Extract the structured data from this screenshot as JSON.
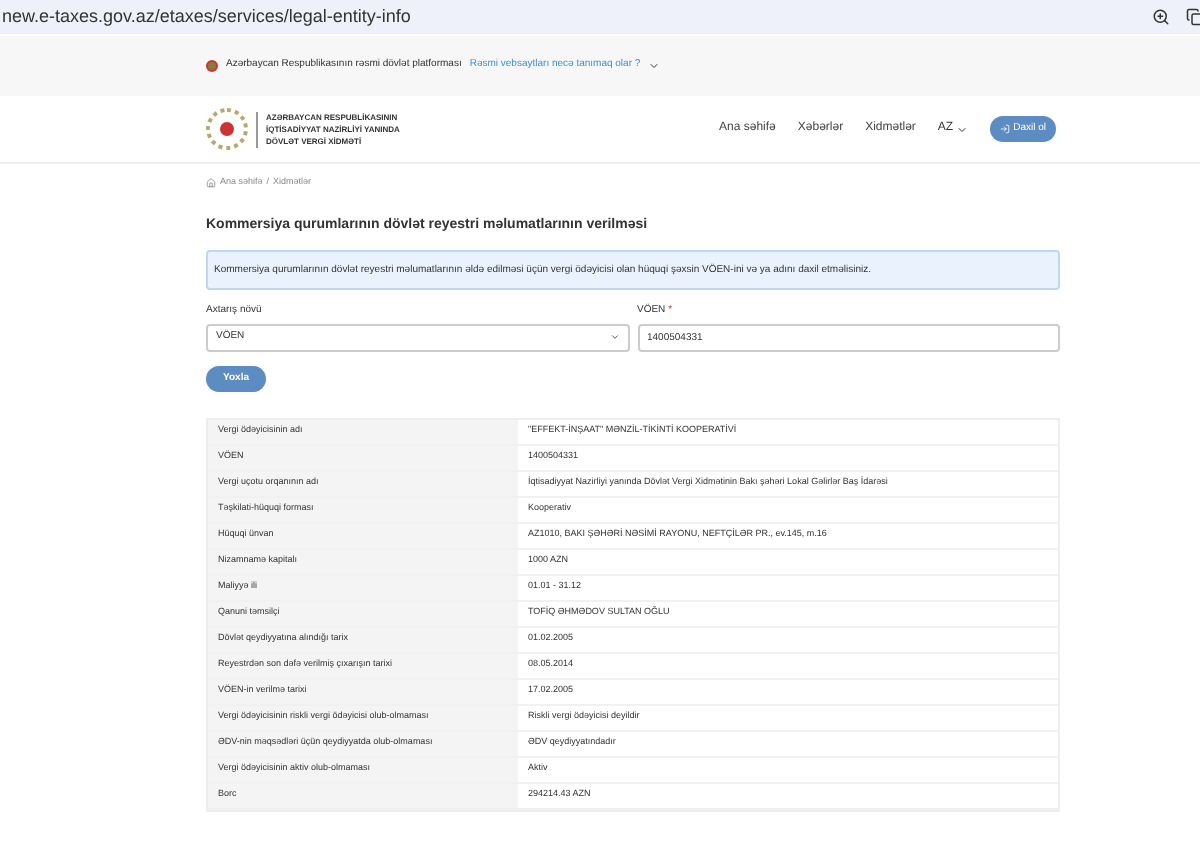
{
  "browser": {
    "url": "new.e-taxes.gov.az/etaxes/services/legal-entity-info"
  },
  "banner": {
    "text": "Azərbaycan Respublikasının rəsmi dövlət platforması",
    "link": "Rəsmi vebsaytları necə tanımaq olar ?"
  },
  "header": {
    "logo_lines": [
      "AZƏRBAYCAN RESPUBLİKASININ",
      "İQTİSADİYYAT NAZİRLİYİ YANINDA",
      "DÖVLƏT VERGİ XİDMƏTİ"
    ],
    "nav": [
      "Ana səhifə",
      "Xəbərlər",
      "Xidmətlər"
    ],
    "language": "AZ",
    "login": "Daxil ol"
  },
  "breadcrumb": [
    "Ana səhifə",
    "Xidmətlər"
  ],
  "breadcrumb_separator": "/",
  "title": "Kommersiya qurumlarının dövlət reyestri məlumatlarının verilməsi",
  "info": "Kommersiya qurumlarının dövlət reyestri məlumatlarının əldə edilməsi üçün vergi ödəyicisi olan hüquqi şəxsin VÖEN-ini və ya adını daxil etməlisiniz.",
  "form": {
    "search_type": {
      "label": "Axtarış növü",
      "value": "VÖEN"
    },
    "voen": {
      "label": "VÖEN",
      "required": "*",
      "value": "1400504331"
    },
    "submit": "Yoxla"
  },
  "table": {
    "rows": [
      {
        "label": "Vergi ödəyicisinin adı",
        "value": "\"EFFEKT-İNŞAAT\" MƏNZİL-TİKİNTİ KOOPERATİVİ"
      },
      {
        "label": "VÖEN",
        "value": "1400504331"
      },
      {
        "label": "Vergi uçotu orqanının adı",
        "value": "İqtisadiyyat Nazirliyi yanında Dövlət Vergi Xidmətinin Bakı şəhəri Lokal Gəlirlər Baş İdarəsi"
      },
      {
        "label": "Təşkilati-hüquqi forması",
        "value": "Kooperativ"
      },
      {
        "label": "Hüquqi ünvan",
        "value": "AZ1010, BAKI ŞƏHƏRİ NƏSİMİ RAYONU, NEFTÇİLƏR PR., ev.145, m.16"
      },
      {
        "label": "Nizamnamə kapitalı",
        "value": "1000 AZN"
      },
      {
        "label": "Maliyyə ili",
        "value": "01.01 - 31.12"
      },
      {
        "label": "Qanuni təmsilçi",
        "value": "TOFİQ ƏHMƏDOV SULTAN OĞLU"
      },
      {
        "label": "Dövlət qeydiyyatına alındığı tarix",
        "value": "01.02.2005"
      },
      {
        "label": "Reyestrdən son dəfə verilmiş çıxarışın tarixi",
        "value": "08.05.2014"
      },
      {
        "label": "VÖEN-in verilmə tarixi",
        "value": "17.02.2005"
      },
      {
        "label": "Vergi ödəyicisinin riskli vergi ödəyicisi olub-olmaması",
        "value": "Riskli vergi ödəyicisi deyildir"
      },
      {
        "label": "ƏDV-nin məqsədləri üçün qeydiyyatda olub-olmaması",
        "value": "ƏDV qeydiyyatındadır"
      },
      {
        "label": "Vergi ödəyicisinin aktiv olub-olmaması",
        "value": "Aktiv"
      },
      {
        "label": "Borc",
        "value": "294214.43 AZN"
      }
    ]
  }
}
